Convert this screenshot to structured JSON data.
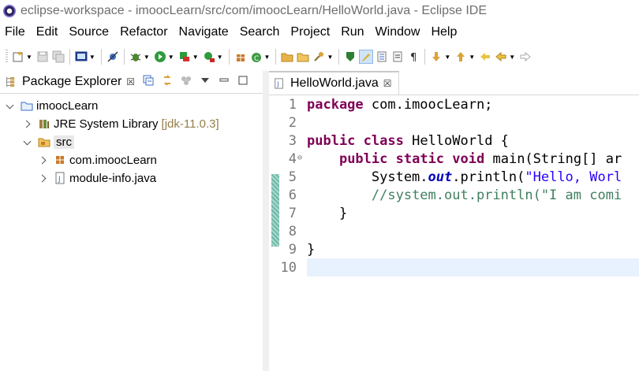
{
  "window": {
    "title": "eclipse-workspace - imoocLearn/src/com/imoocLearn/HelloWorld.java - Eclipse IDE"
  },
  "menu": [
    "File",
    "Edit",
    "Source",
    "Refactor",
    "Navigate",
    "Search",
    "Project",
    "Run",
    "Window",
    "Help"
  ],
  "toolbar": {
    "icons": [
      "new-icon",
      "save-icon",
      "save-all-icon",
      "terminal-icon",
      "skip-breakpoints-icon",
      "debug-icon",
      "run-icon",
      "coverage-icon",
      "external-tools-icon",
      "new-java-package-icon",
      "new-java-class-icon",
      "open-type-icon",
      "open-task-icon",
      "search-icon",
      "toggle-mark-occurrences-icon",
      "toggle-highlight-icon",
      "block-selection-icon",
      "show-whitespace-icon",
      "next-annotation-icon",
      "previous-annotation-icon",
      "last-edit-icon",
      "back-icon",
      "forward-icon"
    ]
  },
  "package_explorer": {
    "tab_label": "Package Explorer",
    "close_symbol": "☒",
    "tree": [
      {
        "label": "imoocLearn",
        "level": 0,
        "expanded": true,
        "icon": "project-icon"
      },
      {
        "label": "JRE System Library",
        "suffix": "[jdk-11.0.3]",
        "level": 1,
        "expanded": false,
        "icon": "library-icon"
      },
      {
        "label": "src",
        "level": 1,
        "expanded": true,
        "icon": "source-folder-icon"
      },
      {
        "label": "com.imoocLearn",
        "level": 2,
        "expanded": false,
        "icon": "package-icon"
      },
      {
        "label": "module-info.java",
        "level": 2,
        "expanded": false,
        "icon": "java-file-icon"
      }
    ]
  },
  "editor": {
    "tab_label": "HelloWorld.java",
    "close_symbol": "☒",
    "current_line": 10,
    "lines": [
      {
        "n": "1",
        "code": "package com.imoocLearn;"
      },
      {
        "n": "2",
        "code": ""
      },
      {
        "n": "3",
        "code": "public class HelloWorld {"
      },
      {
        "n": "4",
        "code": "    public static void main(String[] ar"
      },
      {
        "n": "5",
        "code": "        System.out.println(\"Hello, Worl"
      },
      {
        "n": "6",
        "code": "        //system.out.println(\"I am comi"
      },
      {
        "n": "7",
        "code": "    }"
      },
      {
        "n": "8",
        "code": ""
      },
      {
        "n": "9",
        "code": "}"
      },
      {
        "n": "10",
        "code": ""
      }
    ]
  },
  "colors": {
    "keyword": "#7f0055",
    "string": "#2a00ff",
    "comment": "#3f7f5f",
    "static_field": "#0000c0",
    "line_number": "#787878",
    "current_line": "#e8f2fe"
  }
}
